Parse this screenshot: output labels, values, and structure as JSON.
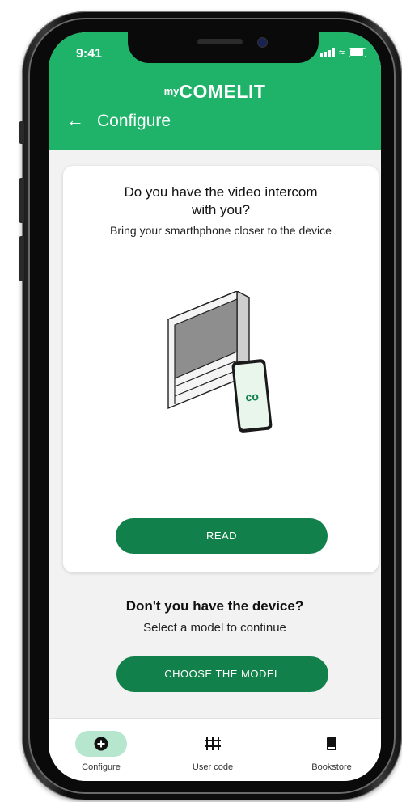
{
  "status_bar": {
    "time": "9:41"
  },
  "header": {
    "logo_prefix": "my",
    "logo_brand": "COMELIT",
    "title": "Configure"
  },
  "card": {
    "title": "Do you have the video intercom with you?",
    "subtitle": "Bring your smarthphone closer to the device",
    "button_label": "READ"
  },
  "fallback": {
    "title": "Don't you have the device?",
    "subtitle": "Select a model to continue",
    "button_label": "CHOOSE THE MODEL"
  },
  "tabbar": {
    "items": [
      {
        "label": "Configure",
        "icon": "plus-circle-icon",
        "active": true
      },
      {
        "label": "User code",
        "icon": "keypad-icon",
        "active": false
      },
      {
        "label": "Bookstore",
        "icon": "book-icon",
        "active": false
      }
    ]
  },
  "colors": {
    "brand_green": "#1fb36a",
    "button_green": "#11804a",
    "active_tab_bg": "#b7e6cf"
  }
}
